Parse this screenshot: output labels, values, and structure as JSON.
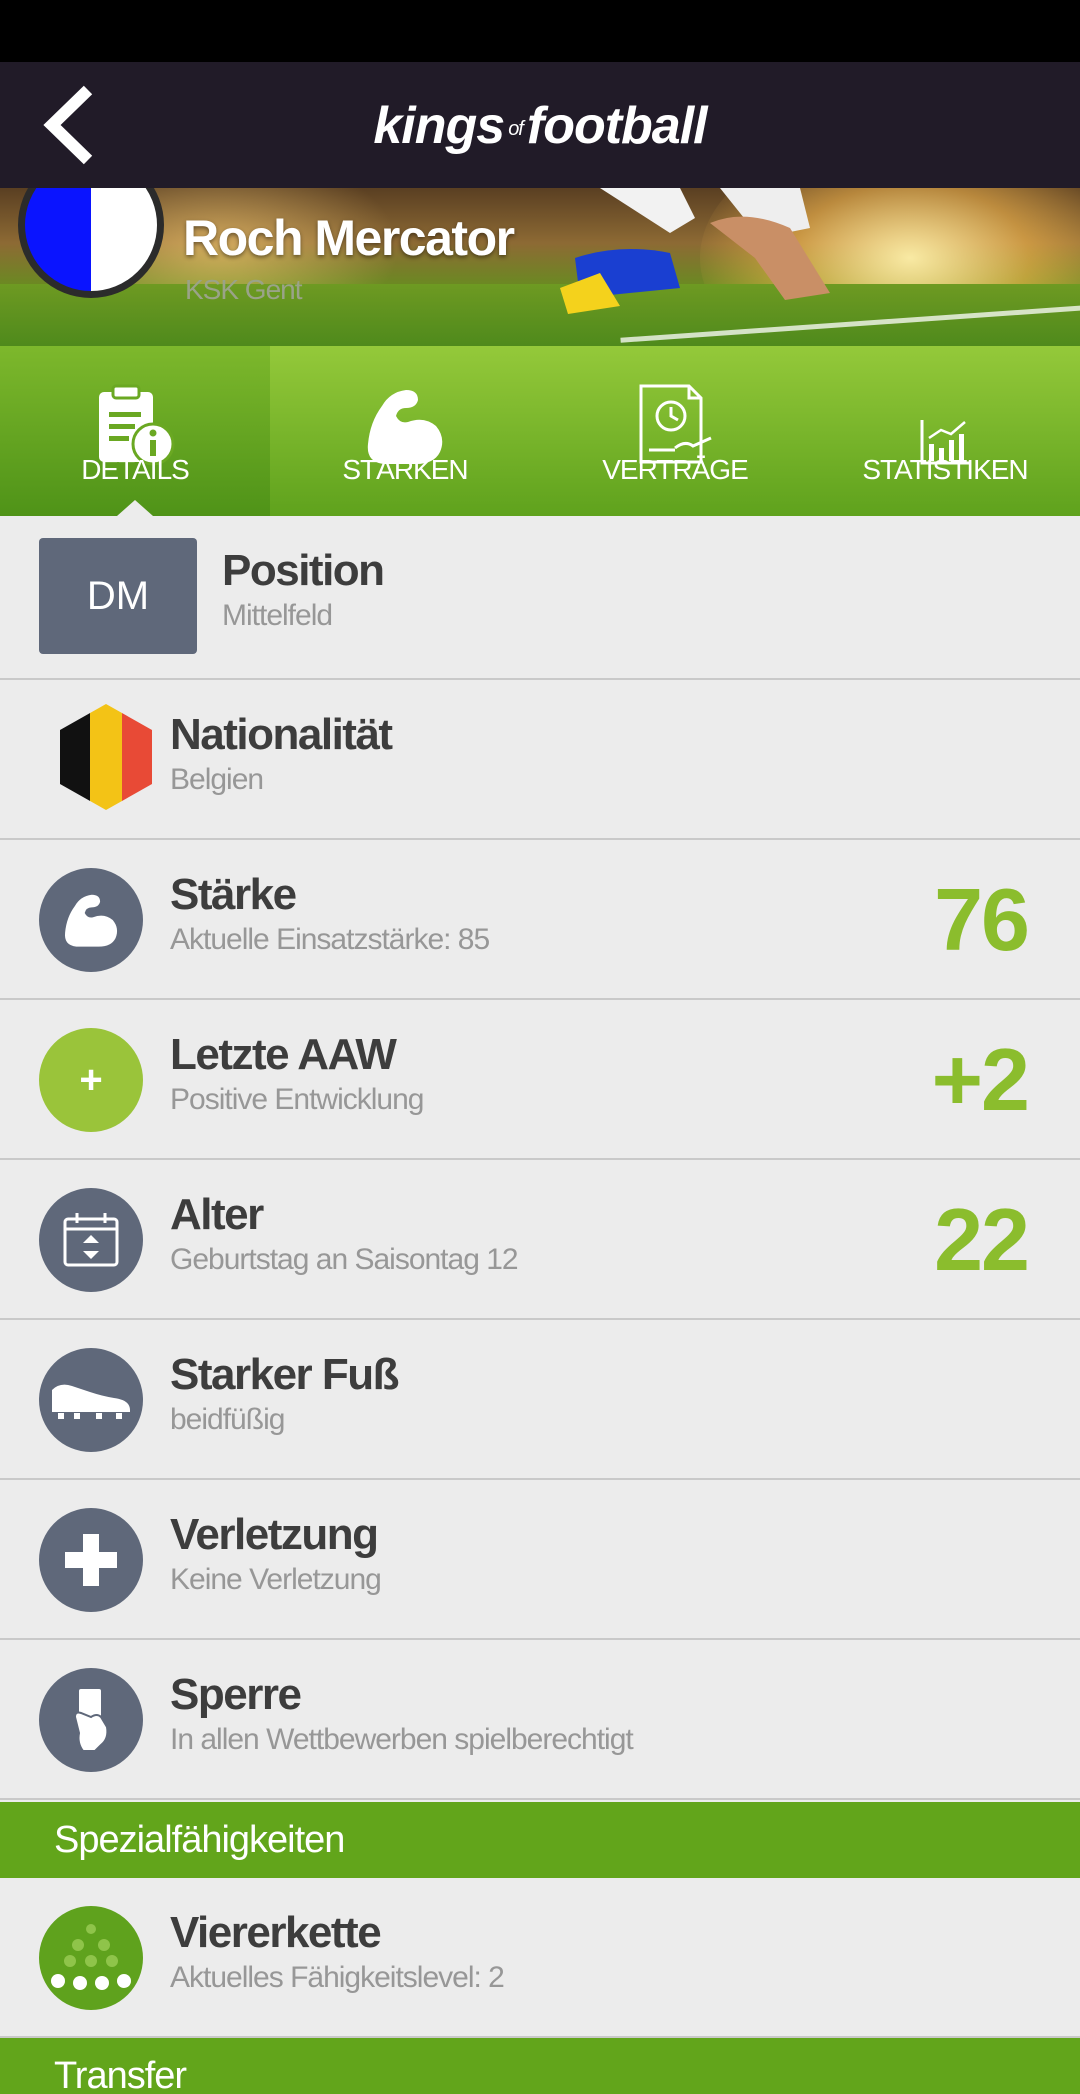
{
  "header": {
    "logo_main": "kings",
    "logo_of": "of",
    "logo_end": "football"
  },
  "player": {
    "name": "Roch Mercator",
    "club": "KSK Gent"
  },
  "tabs": [
    {
      "label": "DETAILS",
      "active": true
    },
    {
      "label": "STÄRKEN",
      "active": false
    },
    {
      "label": "VERTRÄGE",
      "active": false
    },
    {
      "label": "STATISTIKEN",
      "active": false
    }
  ],
  "details": {
    "position": {
      "badge": "DM",
      "title": "Position",
      "sub": "Mittelfeld"
    },
    "nationality": {
      "title": "Nationalität",
      "sub": "Belgien"
    },
    "strength": {
      "title": "Stärke",
      "sub": "Aktuelle Einsatzstärke: 85",
      "value": "76"
    },
    "last_aaw": {
      "icon_symbol": "+",
      "title": "Letzte AAW",
      "sub": "Positive Entwicklung",
      "value": "+2"
    },
    "age": {
      "title": "Alter",
      "sub": "Geburtstag an Saisontag 12",
      "value": "22"
    },
    "foot": {
      "title": "Starker Fuß",
      "sub": "beidfüßig"
    },
    "injury": {
      "title": "Verletzung",
      "sub": "Keine Verletzung"
    },
    "suspension": {
      "title": "Sperre",
      "sub": "In allen Wettbewerben spielberechtigt"
    }
  },
  "special": {
    "header": "Spezialfähigkeiten",
    "items": [
      {
        "title": "Viererkette",
        "sub": "Aktuelles Fähigkeitslevel: 2"
      }
    ]
  },
  "transfer": {
    "header": "Transfer"
  },
  "colors": {
    "accent_green": "#8bbd2d",
    "header_bg": "#211b28",
    "icon_grey": "#5f687a"
  }
}
